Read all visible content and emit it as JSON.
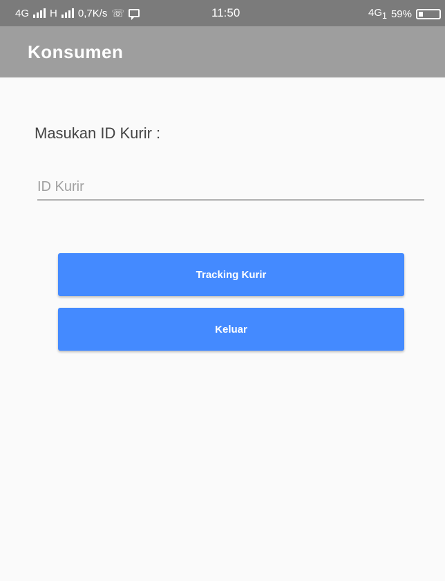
{
  "status_bar": {
    "network_left": "4G",
    "network_mid": "H",
    "speed": "0,7K/s",
    "time": "11:50",
    "network_right": "4G",
    "sim_slot": "1",
    "battery_percent": "59%",
    "icons": [
      "signal-icon",
      "whatsapp-icon",
      "message-icon",
      "battery-icon"
    ]
  },
  "app_bar": {
    "title": "Konsumen"
  },
  "form": {
    "label": "Masukan ID Kurir :",
    "input": {
      "placeholder": "ID Kurir",
      "value": ""
    }
  },
  "buttons": {
    "tracking": "Tracking Kurir",
    "exit": "Keluar"
  },
  "colors": {
    "status_bar": "#7b7b7b",
    "app_bar": "#9e9e9e",
    "button": "#448aff",
    "background": "#fafafa"
  }
}
